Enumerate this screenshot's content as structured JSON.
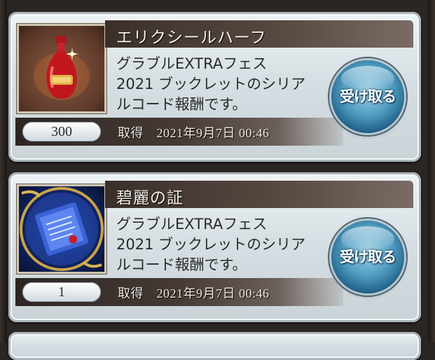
{
  "items": [
    {
      "name": "エリクシールハーフ",
      "icon": "elixir-bottle-icon",
      "description_lines": [
        "グラブルEXTRAフェス",
        "2021 ブックレットのシリア",
        "ルコード報酬です。"
      ],
      "quantity": "300",
      "acquired": "取得　2021年9月7日 00:46",
      "button_label": "受け取る"
    },
    {
      "name": "碧麗の証",
      "icon": "blue-scroll-icon",
      "description_lines": [
        "グラブルEXTRAフェス",
        "2021 ブックレットのシリア",
        "ルコード報酬です。"
      ],
      "quantity": "1",
      "acquired": "取得　2021年9月7日 00:46",
      "button_label": "受け取る"
    }
  ],
  "colors": {
    "button_blue": "#4f9cc0",
    "title_bar": "#3a2f2a",
    "card_bg": "#d6dfe3"
  }
}
